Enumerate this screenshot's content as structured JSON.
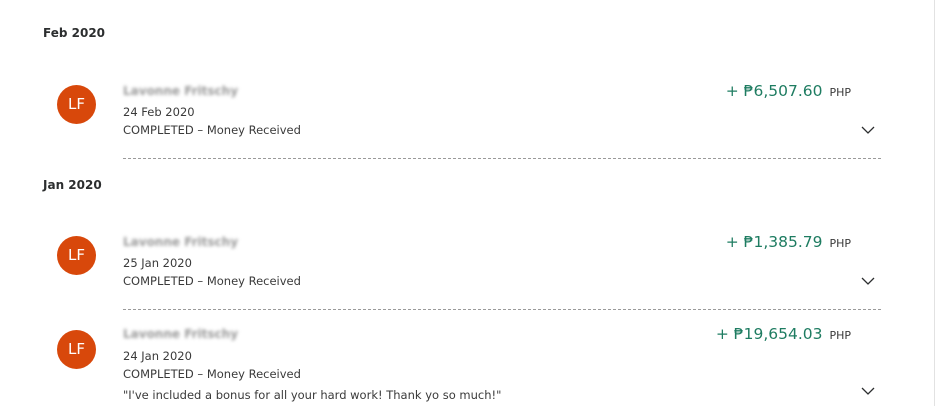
{
  "groups": [
    {
      "month": "Feb 2020",
      "transactions": [
        {
          "initials": "LF",
          "name": "Lavonne Fritschy",
          "date": "24 Feb 2020",
          "status": "COMPLETED – Money Received",
          "amount": "+ ₱6,507.60",
          "currency": "PHP",
          "note": ""
        }
      ]
    },
    {
      "month": "Jan 2020",
      "transactions": [
        {
          "initials": "LF",
          "name": "Lavonne Fritschy",
          "date": "25 Jan 2020",
          "status": "COMPLETED – Money Received",
          "amount": "+ ₱1,385.79",
          "currency": "PHP",
          "note": ""
        },
        {
          "initials": "LF",
          "name": "Lavonne Fritschy",
          "date": "24 Jan 2020",
          "status": "COMPLETED – Money Received",
          "amount": "+ ₱19,654.03",
          "currency": "PHP",
          "note": "\"I've included a bonus for all your hard work! Thank yo so much!\""
        }
      ]
    }
  ],
  "icons": {
    "expand": "chevron-down-icon",
    "avatar": "avatar-initials"
  },
  "colors": {
    "avatar": "#d8480b",
    "amount": "#1e7c61"
  }
}
